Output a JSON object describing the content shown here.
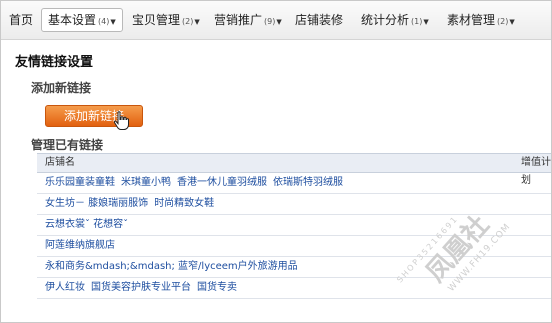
{
  "nav": {
    "items": [
      {
        "label": "首页",
        "count": "",
        "dropdown": false,
        "active": false
      },
      {
        "label": "基本设置",
        "count": "(4)",
        "dropdown": true,
        "active": true
      },
      {
        "label": "宝贝管理",
        "count": "(2)",
        "dropdown": true,
        "active": false
      },
      {
        "label": "营销推广",
        "count": "(9)",
        "dropdown": true,
        "active": false
      },
      {
        "label": "店铺装修",
        "count": "",
        "dropdown": false,
        "active": false
      },
      {
        "label": "统计分析",
        "count": "(1)",
        "dropdown": true,
        "active": false
      },
      {
        "label": "素材管理",
        "count": "(2)",
        "dropdown": true,
        "active": false
      }
    ],
    "caret": "▼"
  },
  "page_title": "友情链接设置",
  "add_section": {
    "heading": "添加新链接",
    "button_label": "添加新链接"
  },
  "manage_section": {
    "heading": "管理已有链接"
  },
  "table": {
    "header_name": "店铺名",
    "header_service": "增值计划",
    "rows": [
      [
        "乐乐园童装童鞋",
        "米琪童小鸭",
        "香港一休儿童羽绒服",
        "依瑞斯特羽绒服"
      ],
      [
        "女生坊－ 膝娘瑞丽服饰",
        "时尚精致女鞋"
      ],
      [
        "云想衣裳ˇ 花想容ˇ"
      ],
      [
        "阿莲维纳旗舰店"
      ],
      [
        "永和商务&mdash;&mdash; 蓝窄/lyceem户外旅游用品"
      ],
      [
        "伊人红妆",
        "国货美容护肤专业平台",
        "国货专卖"
      ]
    ]
  },
  "watermark": {
    "text": "凤凰社",
    "sub": "WWW.FH19.COM",
    "code": "SHOP35216691"
  },
  "colors": {
    "link": "#1f4fa0",
    "button": "#e8731f",
    "header_bg": "#e9edf4"
  },
  "icons": {
    "cursor": "hand-pointer-icon"
  }
}
